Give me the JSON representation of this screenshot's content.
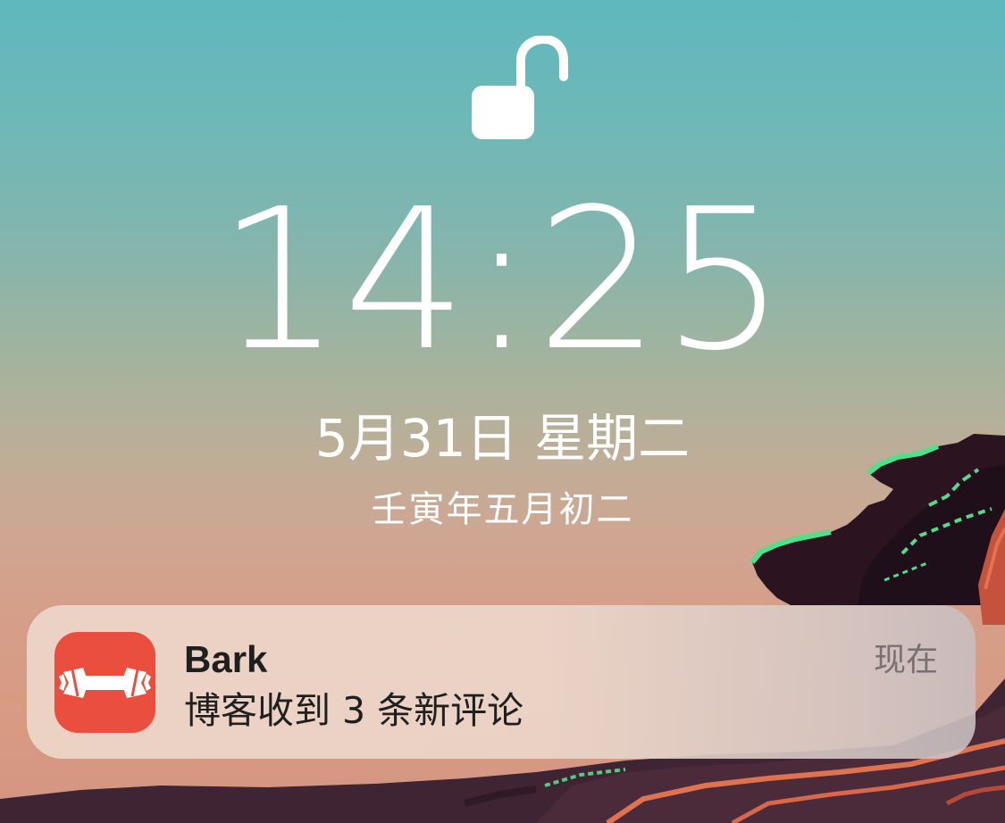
{
  "lockscreen": {
    "time": "14:25",
    "date": "5月31日 星期二",
    "lunar_date": "壬寅年五月初二",
    "lock_icon": "unlocked-padlock-icon"
  },
  "notification": {
    "app_name": "Bark",
    "message": "博客收到 3 条新评论",
    "timestamp": "现在",
    "app_icon": "bark-app-icon",
    "app_icon_color": "#e94e3f"
  },
  "colors": {
    "sky_top": "#5fb8bd",
    "sky_bottom": "#d39582",
    "text": "#ffffff"
  }
}
